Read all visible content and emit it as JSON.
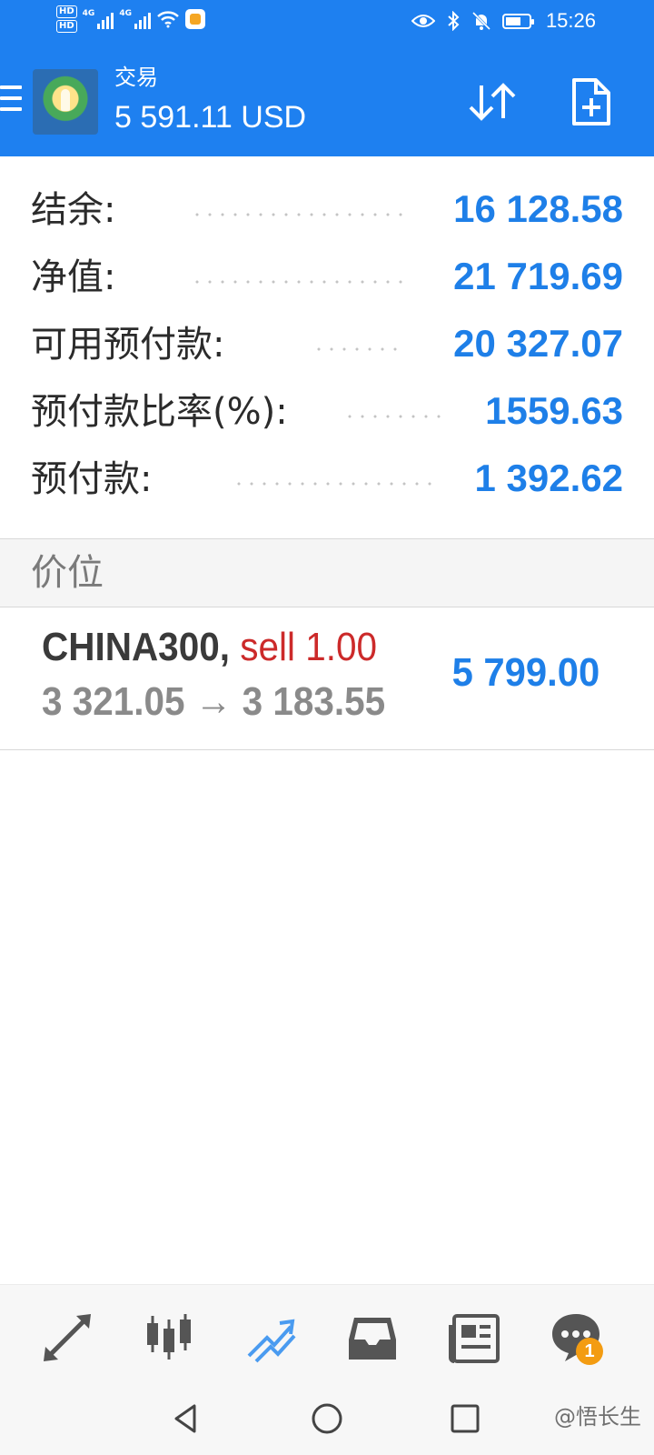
{
  "status_bar": {
    "network_badges": [
      "HD",
      "HD"
    ],
    "network_types": [
      "4G",
      "4G"
    ],
    "time": "15:26",
    "icons": [
      "wifi-icon",
      "eye-icon",
      "bluetooth-icon",
      "mute-bell-icon",
      "battery-icon"
    ]
  },
  "header": {
    "title": "交易",
    "balance": "5 591.11 USD",
    "icons": [
      "menu-icon",
      "metatrader-logo",
      "sort-icon",
      "new-order-icon"
    ]
  },
  "account_summary": [
    {
      "label": "结余:",
      "value": "16 128.58"
    },
    {
      "label": "净值:",
      "value": "21 719.69"
    },
    {
      "label": "可用预付款:",
      "value": "20 327.07"
    },
    {
      "label": "预付款比率(%):",
      "value": "1559.63"
    },
    {
      "label": "预付款:",
      "value": "1 392.62"
    }
  ],
  "positions_header": "价位",
  "positions": [
    {
      "symbol": "CHINA300",
      "separator": ", ",
      "type": "sell",
      "volume": "1.00",
      "open_price": "3 321.05",
      "arrow": "→",
      "current_price": "3 183.55",
      "profit": "5 799.00"
    }
  ],
  "bottom_nav": {
    "items": [
      "quotes-icon",
      "chart-icon",
      "trade-icon",
      "history-icon",
      "news-icon",
      "chat-icon"
    ],
    "active": "trade-icon",
    "chat_badge": "1"
  },
  "system_nav": [
    "back-icon",
    "home-icon",
    "recents-icon"
  ],
  "watermark": "@悟长生",
  "colors": {
    "primary": "#1e80f0",
    "value_blue": "#1e7fe8",
    "sell_red": "#cc2a2a",
    "badge_orange": "#f39c12"
  }
}
